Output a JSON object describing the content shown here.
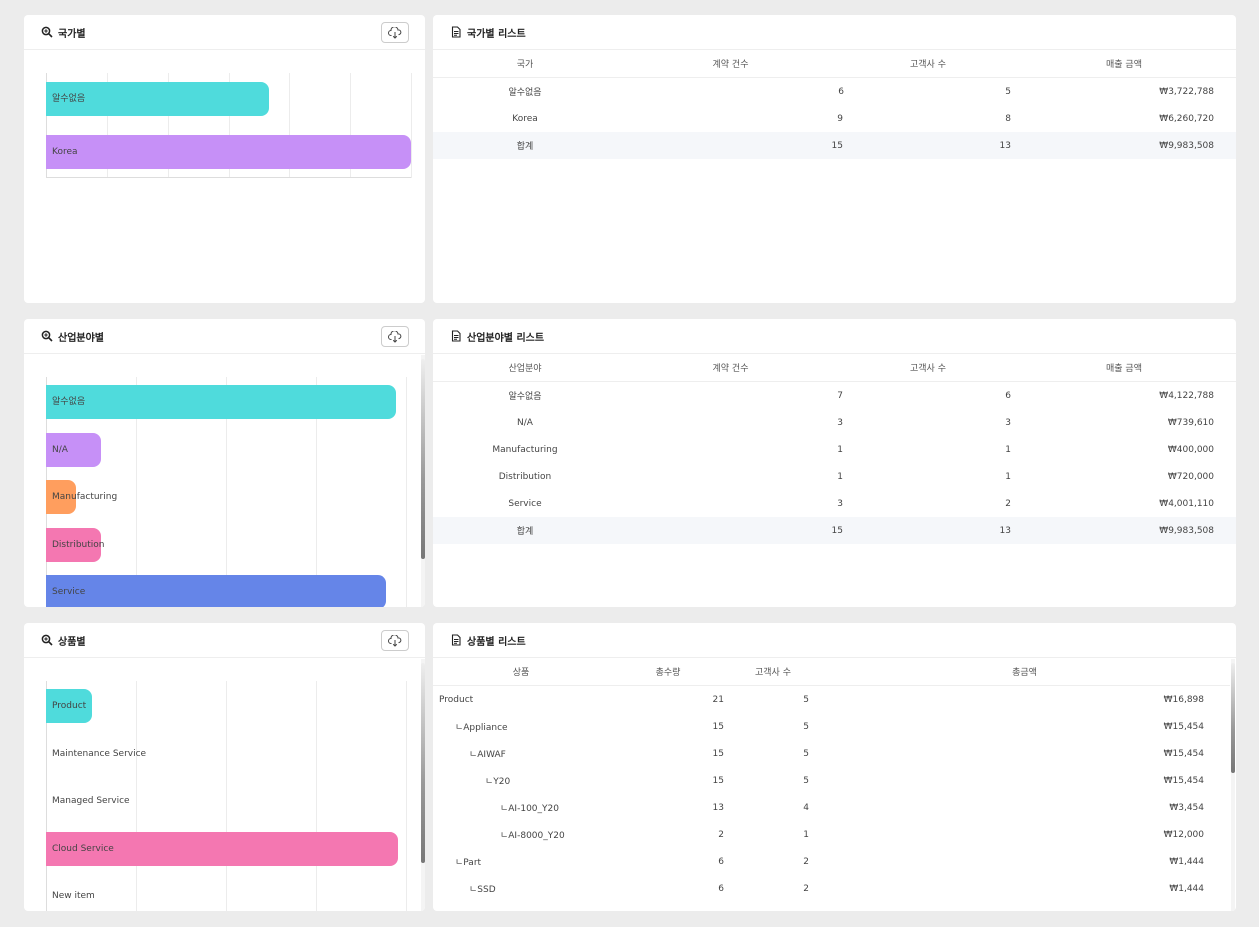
{
  "panels": {
    "country_chart": {
      "title": "국가별"
    },
    "country_list": {
      "title": "국가별 리스트",
      "columns": [
        "국가",
        "계약 건수",
        "고객사 수",
        "매출 금액"
      ],
      "rows": [
        [
          "알수없음",
          "6",
          "5",
          "₩3,722,788"
        ],
        [
          "Korea",
          "9",
          "8",
          "₩6,260,720"
        ],
        [
          "합계",
          "15",
          "13",
          "₩9,983,508"
        ]
      ]
    },
    "industry_chart": {
      "title": "산업분야별"
    },
    "industry_list": {
      "title": "산업분야별 리스트",
      "columns": [
        "산업분야",
        "계약 건수",
        "고객사 수",
        "매출 금액"
      ],
      "rows": [
        [
          "알수없음",
          "7",
          "6",
          "₩4,122,788"
        ],
        [
          "N/A",
          "3",
          "3",
          "₩739,610"
        ],
        [
          "Manufacturing",
          "1",
          "1",
          "₩400,000"
        ],
        [
          "Distribution",
          "1",
          "1",
          "₩720,000"
        ],
        [
          "Service",
          "3",
          "2",
          "₩4,001,110"
        ],
        [
          "합계",
          "15",
          "13",
          "₩9,983,508"
        ]
      ]
    },
    "product_chart": {
      "title": "상품별"
    },
    "product_list": {
      "title": "상품별 리스트",
      "columns": [
        "상품",
        "총수량",
        "고객사 수",
        "총금액"
      ],
      "rows": [
        [
          "Product",
          "21",
          "5",
          "₩16,898"
        ],
        [
          "ㄴAppliance",
          "15",
          "5",
          "₩15,454"
        ],
        [
          "ㄴAIWAF",
          "15",
          "5",
          "₩15,454"
        ],
        [
          "ㄴY20",
          "15",
          "5",
          "₩15,454"
        ],
        [
          "ㄴAI-100_Y20",
          "13",
          "4",
          "₩3,454"
        ],
        [
          "ㄴAI-8000_Y20",
          "2",
          "1",
          "₩12,000"
        ],
        [
          "ㄴPart",
          "6",
          "2",
          "₩1,444"
        ],
        [
          "ㄴSSD",
          "6",
          "2",
          "₩1,444"
        ]
      ]
    }
  },
  "chart_data": [
    {
      "type": "bar",
      "orientation": "horizontal",
      "categories": [
        "알수없음",
        "Korea"
      ],
      "values": [
        6,
        9.8
      ],
      "colors": [
        "#4fdbdc",
        "#c690f7"
      ]
    },
    {
      "type": "bar",
      "orientation": "horizontal",
      "categories": [
        "알수없음",
        "N/A",
        "Manufacturing",
        "Distribution",
        "Service"
      ],
      "values": [
        7,
        1.1,
        0.6,
        1.1,
        6.8
      ],
      "colors": [
        "#4fdbdc",
        "#c690f7",
        "#ff9e5e",
        "#f477b1",
        "#6585e8"
      ]
    },
    {
      "type": "bar",
      "orientation": "horizontal",
      "categories": [
        "Product",
        "Maintenance Service",
        "Managed Service",
        "Cloud Service",
        "New item"
      ],
      "values": [
        0.55,
        0,
        0,
        4.2,
        0
      ],
      "colors": [
        "#4fdbdc",
        "#c690f7",
        "#ff9e5e",
        "#f477b1",
        "#6585e8"
      ]
    }
  ]
}
